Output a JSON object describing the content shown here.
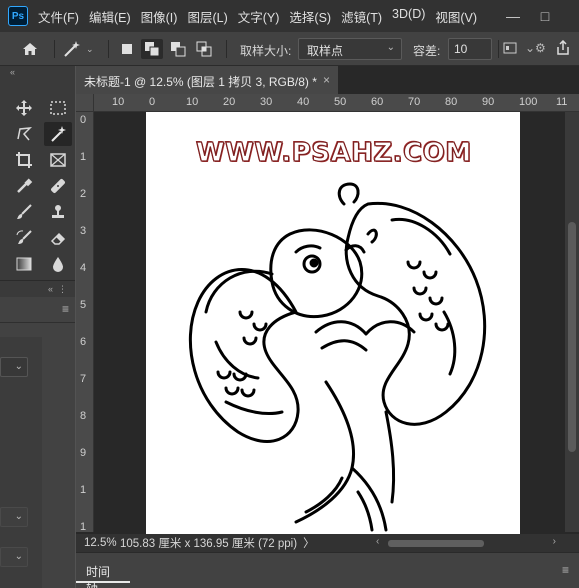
{
  "app": {
    "logo_text": "Ps"
  },
  "menu": [
    "文件(F)",
    "编辑(E)",
    "图像(I)",
    "图层(L)",
    "文字(Y)",
    "选择(S)",
    "滤镜(T)",
    "3D(D)",
    "视图(V)"
  ],
  "options": {
    "sample_size_label": "取样大小:",
    "sample_size_value": "取样点",
    "tolerance_label": "容差:",
    "tolerance_value": "10"
  },
  "document": {
    "tab_title": "未标题-1 @ 12.5% (图层 1 拷贝 3, RGB/8) *",
    "close_glyph": "×",
    "ruler_h": [
      "10",
      "0",
      "10",
      "20",
      "30",
      "40",
      "50",
      "60",
      "70",
      "80",
      "90",
      "100",
      "11"
    ],
    "ruler_v": [
      "0",
      "1",
      "2",
      "3",
      "4",
      "5",
      "6",
      "7",
      "8",
      "9",
      "1",
      "1"
    ],
    "canvas_text": "WWW.PSAHZ.COM"
  },
  "status": {
    "zoom": "12.5%",
    "info": "105.83 厘米 x 136.95 厘米 (72 ppi)",
    "arrow": "〉"
  },
  "timeline": {
    "tab_label": "时间轴"
  },
  "colors": {
    "accent": "#31a8ff",
    "watermark_stroke": "#7a1f1f"
  }
}
